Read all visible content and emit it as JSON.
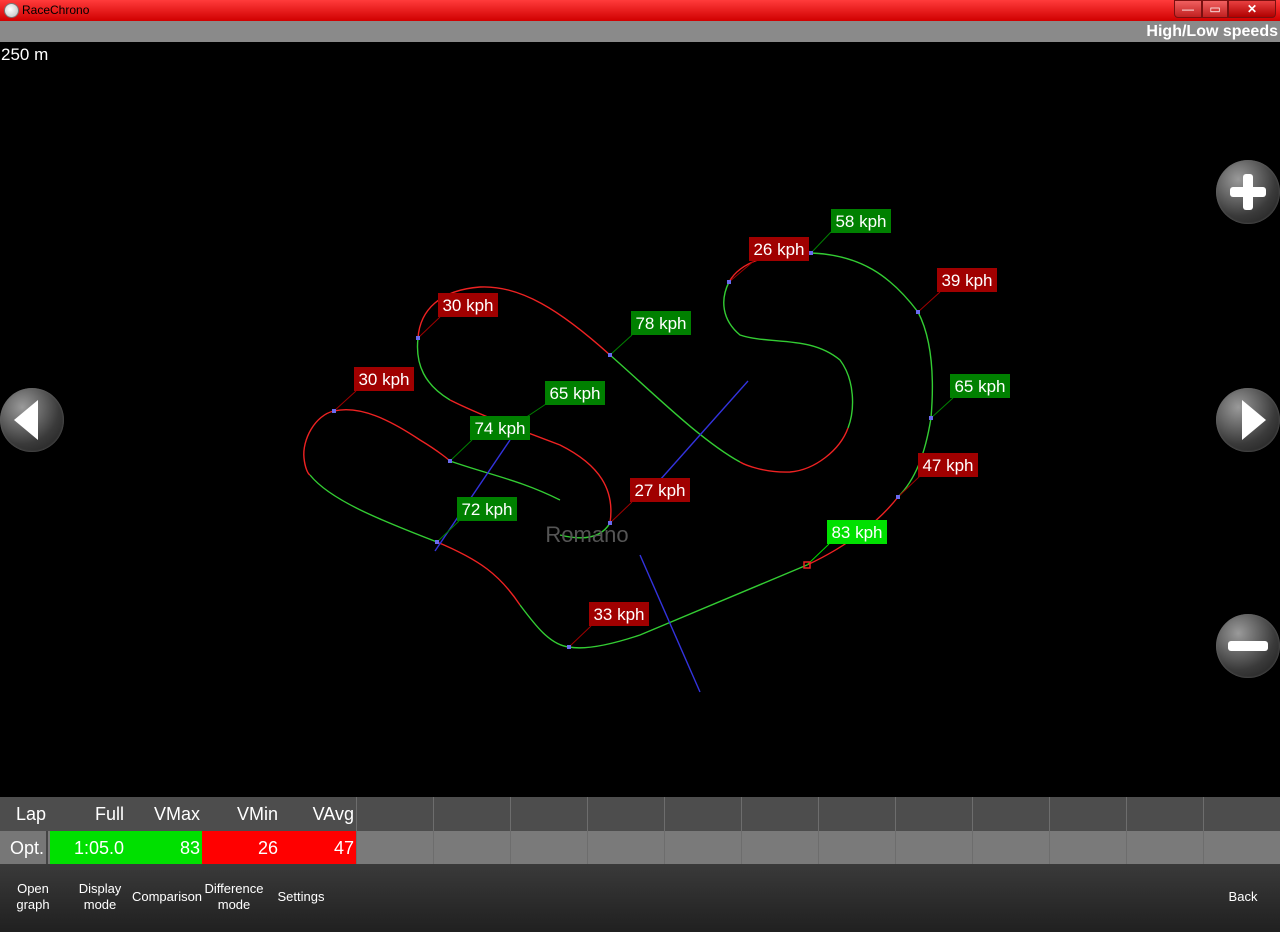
{
  "window": {
    "title": "RaceChrono",
    "min": "—",
    "max": "▭",
    "close": "✕"
  },
  "header": {
    "mode": "High/Low speeds"
  },
  "map": {
    "scale": "250 m",
    "track_name": "Romano",
    "labels": [
      {
        "text": "58 kph",
        "type": "high"
      },
      {
        "text": "26 kph",
        "type": "low"
      },
      {
        "text": "39 kph",
        "type": "low"
      },
      {
        "text": "30 kph",
        "type": "low"
      },
      {
        "text": "78 kph",
        "type": "high"
      },
      {
        "text": "30 kph",
        "type": "low"
      },
      {
        "text": "65 kph",
        "type": "high"
      },
      {
        "text": "65 kph",
        "type": "high"
      },
      {
        "text": "74 kph",
        "type": "high"
      },
      {
        "text": "47 kph",
        "type": "low"
      },
      {
        "text": "27 kph",
        "type": "low"
      },
      {
        "text": "72 kph",
        "type": "high"
      },
      {
        "text": "83 kph",
        "type": "max"
      },
      {
        "text": "33 kph",
        "type": "low"
      }
    ]
  },
  "table": {
    "headers": [
      "Lap",
      "Full",
      "VMax",
      "VMin",
      "VAvg"
    ],
    "row": {
      "lap": "Opt.",
      "full": "1:05.0",
      "vmax": "83",
      "vmin": "26",
      "vavg": "47"
    }
  },
  "toolbar": {
    "open_graph": "Open\ngraph",
    "display_mode": "Display\nmode",
    "comparison": "Comparison",
    "difference_mode": "Difference\nmode",
    "settings": "Settings",
    "back": "Back"
  },
  "colors": {
    "high": "#008000",
    "max": "#00e000",
    "low": "#a00000",
    "track_green": "#33cc33",
    "track_red": "#ee2222",
    "sector_line": "#3333dd"
  }
}
